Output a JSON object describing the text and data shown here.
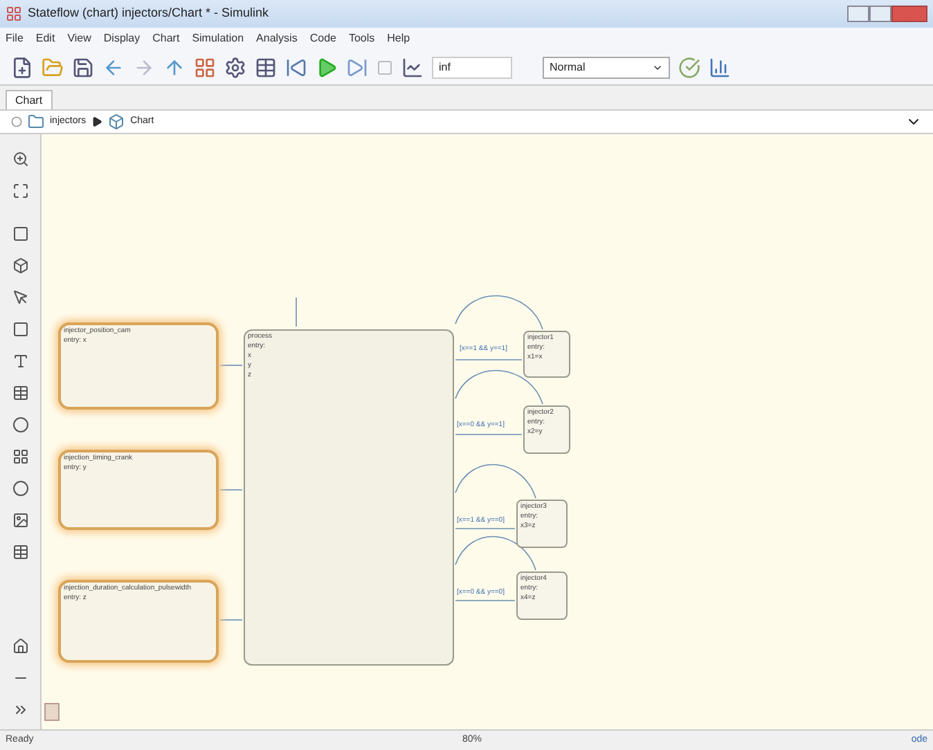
{
  "window": {
    "title": "Stateflow (chart) injectors/Chart * - Simulink"
  },
  "menu": [
    "File",
    "Edit",
    "View",
    "Display",
    "Chart",
    "Simulation",
    "Analysis",
    "Code",
    "Tools",
    "Help"
  ],
  "toolbar": {
    "stop_time": "inf",
    "mode": "Normal"
  },
  "tabs": [
    {
      "label": "Chart",
      "selected": true
    }
  ],
  "breadcrumb": [
    "injectors",
    "Chart"
  ],
  "chart": {
    "states": [
      {
        "kind": "source",
        "active": true,
        "name": "injector_position_cam",
        "lines": [
          "entry: x"
        ]
      },
      {
        "kind": "source",
        "active": true,
        "name": "injection_timing_crank",
        "lines": [
          "entry: y"
        ]
      },
      {
        "kind": "source",
        "active": true,
        "name": "injection_duration_calculation_pulsewidth",
        "lines": [
          "entry: z"
        ]
      },
      {
        "kind": "process",
        "active": false,
        "name": "process",
        "lines": [
          "entry:",
          "x",
          "y",
          "z"
        ]
      },
      {
        "kind": "injector",
        "active": false,
        "name": "injector1",
        "lines": [
          "entry:",
          "x1=x"
        ]
      },
      {
        "kind": "injector",
        "active": false,
        "name": "injector2",
        "lines": [
          "entry:",
          "x2=y"
        ]
      },
      {
        "kind": "injector",
        "active": false,
        "name": "injector3",
        "lines": [
          "entry:",
          "x3=z"
        ]
      },
      {
        "kind": "injector",
        "active": false,
        "name": "injector4",
        "lines": [
          "entry:",
          "x4=z"
        ]
      }
    ],
    "transitions": [
      "[x==1 && y==1]",
      "[x==0 && y==1]",
      "[x==1 && y==0]",
      "[x==0 && y==0]"
    ]
  },
  "status_bar": {
    "state": "Ready",
    "zoom": "80%",
    "solver": "ode"
  }
}
